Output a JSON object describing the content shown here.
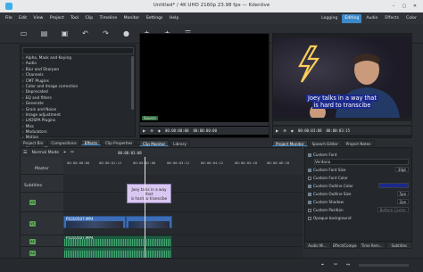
{
  "window": {
    "title": "Untitled* / 4K UHD 2160p 23.98 fps — Kdenlive",
    "minimize": "–",
    "maximize": "▢",
    "close": "✕"
  },
  "menu": [
    "File",
    "Edit",
    "View",
    "Project",
    "Tool",
    "Clip",
    "Timeline",
    "Monitor",
    "Settings",
    "Help"
  ],
  "layouts": {
    "items": [
      "Logging",
      "Editing",
      "Audio",
      "Effects",
      "Color"
    ],
    "active": "Editing"
  },
  "effects_library": {
    "items": [
      "Alpha, Mask and Keying",
      "Audio",
      "Blur and Sharpen",
      "Channels",
      "CMT Plugins",
      "Color and Image correction",
      "Deprecated",
      "EQ and filters",
      "Generate",
      "Grain and Noise",
      "Image adjustment",
      "LADSPA Plugins",
      "Misc",
      "Modulators",
      "Motion",
      "On Master",
      "Pitch and Time"
    ]
  },
  "left_tabs": {
    "items": [
      "Project Bin",
      "Compositions",
      "Effects",
      "Clip Properties",
      "Undo History"
    ],
    "active": "Effects"
  },
  "clip_monitor": {
    "source": "Source",
    "timecode_left": "00:00:00:00",
    "timecode_right": "00:00:00:00",
    "tabs": [
      "Clip Monitor",
      "Library"
    ],
    "active_tab": "Clip Monitor"
  },
  "project_monitor": {
    "subtitle_line1": "Joey talks in a way that",
    "subtitle_line2": "is hard to transcibe",
    "timecode_left": "00:00:03:08",
    "timecode_right": "00:00:03:15",
    "tabs": [
      "Project Monitor",
      "Speech Editor",
      "Project Notes"
    ],
    "active_tab": "Project Monitor"
  },
  "timeline": {
    "mode": "Normal Mode",
    "timecode": "00:00:03:08",
    "ruler": [
      "00:00:00:00",
      "00:00:01:12",
      "00:00:02:00",
      "00:00:03:12",
      "00:00:04:12",
      "00:00:05:18",
      "00:00:06:18",
      "00:00:07:00"
    ],
    "master_label": "Master",
    "subtitles_label": "Subtitles",
    "tracks": [
      {
        "badge": "V2",
        "kind": "video"
      },
      {
        "badge": "V1",
        "kind": "video"
      },
      {
        "badge": "A1",
        "kind": "audio"
      },
      {
        "badge": "A2",
        "kind": "audio"
      }
    ],
    "subtitle_clip_line1": "Joey talks in a way that",
    "subtitle_clip_line2": "is hard to transcibe",
    "video_clip_1": "P1010507.MP4",
    "video_clip_2": "P1010507.MP4"
  },
  "subtitle_props": {
    "rows": [
      {
        "label": "Custom Font",
        "checked": true,
        "value": ""
      },
      {
        "label": "Verdana",
        "checked": null,
        "value": ""
      },
      {
        "label": "Custom Font Size",
        "checked": true,
        "value": "30pt"
      },
      {
        "label": "Custom Font Color",
        "checked": false,
        "value": ""
      },
      {
        "label": "Custom Outline Color",
        "checked": true,
        "value": ""
      },
      {
        "label": "Custom Outline Size",
        "checked": true,
        "value": "5px"
      },
      {
        "label": "Custom Shadow",
        "checked": true,
        "value": "2px"
      },
      {
        "label": "Custom Position",
        "checked": false,
        "value": "Bottom Center"
      },
      {
        "label": "Opaque background",
        "checked": false,
        "value": ""
      }
    ],
    "bottom_tabs": [
      "Audio Mi...",
      "Effect/Compositio...",
      "Time Rem...",
      "Subtitles"
    ]
  },
  "colors": {
    "accent": "#3d88c7",
    "video_clip": "#3c6db5",
    "audio_clip": "#1f5b43",
    "subtitle_clip": "#d8c7f0",
    "track_badge": "#5ca857"
  }
}
